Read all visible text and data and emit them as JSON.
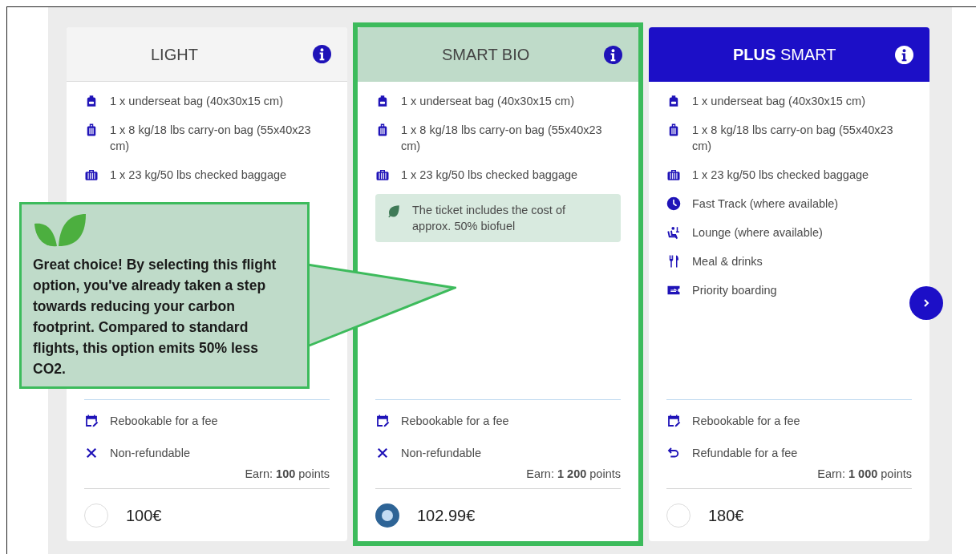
{
  "cards": [
    {
      "kind": "light",
      "title": "LIGHT",
      "selected": false,
      "features": [
        {
          "kind": "underseat",
          "text": "1 x underseat bag (40x30x15 cm)"
        },
        {
          "kind": "carry-on",
          "text": "1 x 8 kg/18 lbs carry-on bag (55x40x23 cm)"
        },
        {
          "kind": "checked",
          "text": "1 x 23 kg/50 lbs checked baggage"
        }
      ],
      "conditions": [
        {
          "kind": "rebook",
          "text": "Rebookable for a fee"
        },
        {
          "kind": "no-refund",
          "text": "Non-refundable"
        }
      ],
      "earn": "Earn: **100** points",
      "price": "100€"
    },
    {
      "kind": "bio",
      "title": "SMART BIO",
      "selected": true,
      "features": [
        {
          "kind": "underseat",
          "text": "1 x underseat bag (40x30x15 cm)"
        },
        {
          "kind": "carry-on",
          "text": "1 x 8 kg/18 lbs carry-on bag (55x40x23 cm)"
        },
        {
          "kind": "checked",
          "text": "1 x 23 kg/50 lbs checked baggage"
        }
      ],
      "note": "The ticket includes the cost of approx. 50% biofuel",
      "conditions": [
        {
          "kind": "rebook",
          "text": "Rebookable for a fee"
        },
        {
          "kind": "no-refund",
          "text": "Non-refundable"
        }
      ],
      "earn": "Earn: **1 200** points",
      "price": "102.99€"
    },
    {
      "kind": "premium",
      "title": "**PLUS** SMART",
      "selected": false,
      "features": [
        {
          "kind": "underseat",
          "text": "1 x underseat bag (40x30x15 cm)"
        },
        {
          "kind": "carry-on",
          "text": "1 x 8 kg/18 lbs carry-on bag (55x40x23 cm)"
        },
        {
          "kind": "checked",
          "text": "1 x 23 kg/50 lbs checked baggage"
        },
        {
          "kind": "clock",
          "text": "Fast Track (where available)"
        },
        {
          "kind": "lounge",
          "text": "Lounge (where available)"
        },
        {
          "kind": "meal",
          "text": "Meal & drinks"
        },
        {
          "kind": "boarding",
          "text": "Priority boarding"
        }
      ],
      "conditions": [
        {
          "kind": "rebook",
          "text": "Rebookable for a fee"
        },
        {
          "kind": "refund",
          "text": "Refundable for a fee"
        }
      ],
      "earn": "Earn: **1 000** points",
      "price": "180€"
    }
  ],
  "callout": {
    "text": "Great choice! By selecting this flight option, you've already taken a step towards reducing your carbon footprint. Compared to standard flights, this option emits 50% less CO2."
  }
}
